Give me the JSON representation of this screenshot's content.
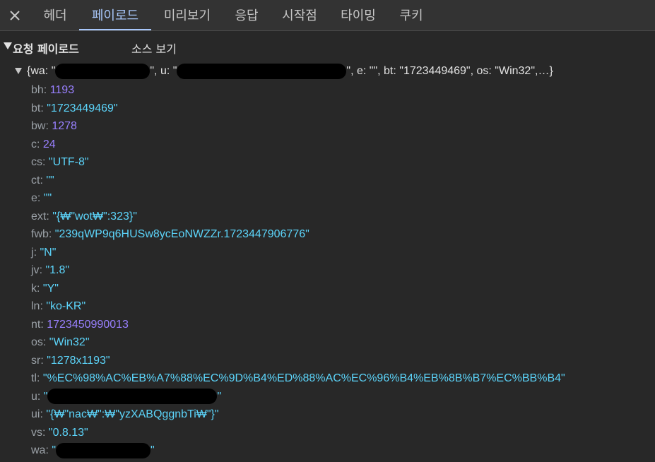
{
  "tabs": {
    "close_label": "×",
    "items": [
      {
        "label": "헤더",
        "active": false
      },
      {
        "label": "페이로드",
        "active": true
      },
      {
        "label": "미리보기",
        "active": false
      },
      {
        "label": "응답",
        "active": false
      },
      {
        "label": "시작점",
        "active": false
      },
      {
        "label": "타이밍",
        "active": false
      },
      {
        "label": "쿠키",
        "active": false
      }
    ]
  },
  "section": {
    "title": "요청 페이로드",
    "view_source": "소스 보기"
  },
  "summary": {
    "open": "{wa: \"",
    "mid1": "\", u: \"",
    "mid2": "\", e: \"\", bt: \"1723449469\", os: \"Win32\",…}"
  },
  "properties": [
    {
      "key": "bh",
      "value": "1193",
      "type": "number"
    },
    {
      "key": "bt",
      "value": "\"1723449469\"",
      "type": "string"
    },
    {
      "key": "bw",
      "value": "1278",
      "type": "number"
    },
    {
      "key": "c",
      "value": "24",
      "type": "number"
    },
    {
      "key": "cs",
      "value": "\"UTF-8\"",
      "type": "string"
    },
    {
      "key": "ct",
      "value": "\"\"",
      "type": "string"
    },
    {
      "key": "e",
      "value": "\"\"",
      "type": "string"
    },
    {
      "key": "ext",
      "value": "\"{₩\"wot₩\":323}\"",
      "type": "string"
    },
    {
      "key": "fwb",
      "value": "\"239qWP9q6HUSw8ycEoNWZZr.1723447906776\"",
      "type": "string"
    },
    {
      "key": "j",
      "value": "\"N\"",
      "type": "string"
    },
    {
      "key": "jv",
      "value": "\"1.8\"",
      "type": "string"
    },
    {
      "key": "k",
      "value": "\"Y\"",
      "type": "string"
    },
    {
      "key": "ln",
      "value": "\"ko-KR\"",
      "type": "string"
    },
    {
      "key": "nt",
      "value": "1723450990013",
      "type": "number"
    },
    {
      "key": "os",
      "value": "\"Win32\"",
      "type": "string"
    },
    {
      "key": "sr",
      "value": "\"1278x1193\"",
      "type": "string"
    },
    {
      "key": "tl",
      "value": "\"%EC%98%AC%EB%A7%88%EC%9D%B4%ED%88%AC%EC%96%B4%EB%8B%B7%EC%BB%B4\"",
      "type": "string"
    },
    {
      "key": "u",
      "value": "\"",
      "type": "string",
      "redacted": true,
      "suffix": "\""
    },
    {
      "key": "ui",
      "value": "\"{₩\"nac₩\":₩\"yzXABQggnbTi₩\"}\"",
      "type": "string"
    },
    {
      "key": "vs",
      "value": "\"0.8.13\"",
      "type": "string"
    },
    {
      "key": "wa",
      "value": "\"",
      "type": "string",
      "redacted": true,
      "suffix": "\""
    }
  ],
  "colors": {
    "background": "#282828",
    "tabbar": "#333333",
    "accent": "#a8c7fa",
    "string": "#5cd5fb",
    "number": "#9980ff",
    "key": "#9aa0a6"
  }
}
